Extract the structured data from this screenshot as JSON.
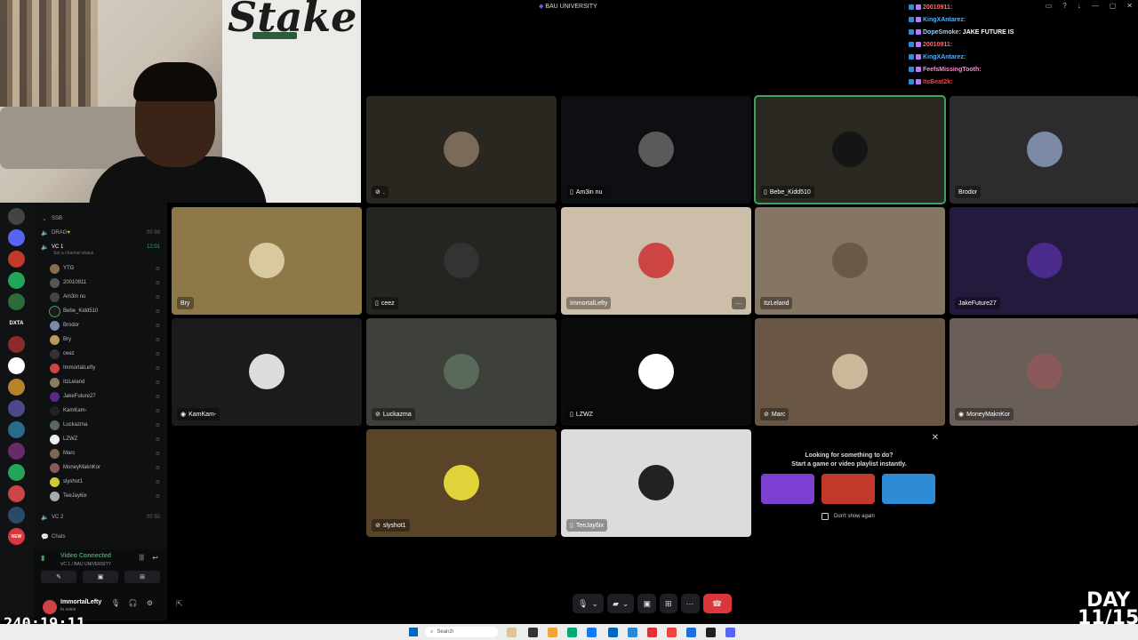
{
  "window": {
    "title": "BAU UNIVERSITY",
    "controls": [
      "▭",
      "?",
      "↓",
      "—",
      "▢",
      "✕"
    ]
  },
  "colors": {
    "discord_green": "#3ba55d",
    "hangup_red": "#da373c",
    "sidebar_bg": "#0f1012"
  },
  "chat": [
    {
      "user": "20010911:",
      "msg": "",
      "color": "#ff6b6b"
    },
    {
      "user": "KingXAntarez:",
      "msg": "",
      "color": "#4fb3ff"
    },
    {
      "user": "DopeSmoke:",
      "msg": "JAKE FUTURE IS",
      "color": "#9ad0ff"
    },
    {
      "user": "20010911:",
      "msg": "",
      "color": "#ff6b6b"
    },
    {
      "user": "KingXAntarez:",
      "msg": "",
      "color": "#4fb3ff"
    },
    {
      "user": "FeefsMissingTooth:",
      "msg": "",
      "color": "#ff8ad8"
    },
    {
      "user": "ItsBeat2k:",
      "msg": "",
      "color": "#ff3b3b"
    }
  ],
  "sidebar": {
    "category": "SSB",
    "channels": [
      {
        "name": "DRAG",
        "counts": "00 99",
        "icon": "speaker-icon"
      },
      {
        "name": "VC 1",
        "counts": "12:01",
        "icon": "speaker-icon",
        "status": "Set a channel status"
      },
      {
        "name": "VC 2",
        "counts": "00 50",
        "icon": "speaker-icon"
      },
      {
        "name": "Chats",
        "counts": "",
        "icon": "chat-icon"
      }
    ],
    "members": [
      {
        "name": "YTG",
        "color": "#8a6b4c"
      },
      {
        "name": "20010911",
        "color": "#555"
      },
      {
        "name": "Am3in nu",
        "color": "#444"
      },
      {
        "name": "Bebe_Kidd510",
        "color": "#1a1a1a"
      },
      {
        "name": "Brodor",
        "color": "#7c8aa8"
      },
      {
        "name": "Bry",
        "color": "#b89a5e"
      },
      {
        "name": "ceez",
        "color": "#333"
      },
      {
        "name": "ImmortalLefty",
        "color": "#c44"
      },
      {
        "name": "ItzLeland",
        "color": "#8b7b62"
      },
      {
        "name": "JakeFuture27",
        "color": "#5a2a8a"
      },
      {
        "name": "KamKam-",
        "color": "#222"
      },
      {
        "name": "Luckazma",
        "color": "#5a6a5a"
      },
      {
        "name": "LZWZ",
        "color": "#eee"
      },
      {
        "name": "Marc",
        "color": "#7c6652"
      },
      {
        "name": "MoneyMaknKor",
        "color": "#8a5a5a"
      },
      {
        "name": "slyshot1",
        "color": "#cc3"
      },
      {
        "name": "TeeJay6ix",
        "color": "#aaa"
      }
    ],
    "voice": {
      "status": "Video Connected",
      "sub": "VC 1 / BAU UNIVERSITY"
    },
    "user": {
      "name": "ImmortalLefty",
      "status": "In voice"
    }
  },
  "tiles": [
    {
      "name": ".",
      "bg": "#2a2620",
      "ava": "#7a6a5a",
      "icon": "mute-icon"
    },
    {
      "name": "Am3in nu",
      "bg": "#0e0f12",
      "ava": "#5a5a5a",
      "icon": "mobile-icon"
    },
    {
      "name": "Bebe_Kidd510",
      "bg": "#2b2822",
      "ava": "#151515",
      "icon": "mobile-icon",
      "speaking": true
    },
    {
      "name": "Brodor",
      "bg": "#2d2b2e",
      "ava": "#7c8aa8",
      "icon": ""
    },
    {
      "name": "Bry",
      "bg": "#8e7848",
      "ava": "#d8c9a0",
      "icon": ""
    },
    {
      "name": "ceez",
      "bg": "#262421",
      "ava": "#333",
      "icon": "mobile-icon"
    },
    {
      "name": "ImmortalLefty",
      "bg": "#cdbeaa",
      "ava": "#c44",
      "icon": "",
      "menu": true
    },
    {
      "name": "ItzLeland",
      "bg": "#847662",
      "ava": "#6a5a45",
      "icon": ""
    },
    {
      "name": "JakeFuture27",
      "bg": "#241a3e",
      "ava": "#4a2a8a",
      "icon": ""
    },
    {
      "name": "KamKam-",
      "bg": "#1b1b1b",
      "ava": "#ddd",
      "icon": "camera-icon"
    },
    {
      "name": "Luckazma",
      "bg": "#3e403c",
      "ava": "#5a6a5a",
      "icon": "mute-icon"
    },
    {
      "name": "LZWZ",
      "bg": "#0b0b0b",
      "ava": "#ffffff",
      "icon": "mobile-icon"
    },
    {
      "name": "Marc",
      "bg": "#6a5645",
      "ava": "#c9b89a",
      "icon": "mute-icon"
    },
    {
      "name": "MoneyMaknKor",
      "bg": "#6a5e58",
      "ava": "#8a5a5a",
      "icon": "camera-icon"
    },
    {
      "name": "slyshot1",
      "bg": "#5a4428",
      "ava": "#e2d23a",
      "icon": "mute-icon"
    },
    {
      "name": "TeeJay6ix",
      "bg": "#dcdcde",
      "ava": "#222",
      "icon": "mobile-icon"
    }
  ],
  "activity": {
    "title_line1": "Looking for something to do?",
    "title_line2": "Start a game or video playlist instantly.",
    "checkbox_label": "Don't show again",
    "games": [
      {
        "label": "",
        "color": "#7b3fd1"
      },
      {
        "label": "",
        "color": "#c0392b"
      },
      {
        "label": "",
        "color": "#2e8bd6"
      }
    ]
  },
  "call_controls": [
    "mic",
    "camera",
    "share-screen",
    "activities",
    "more",
    "hangup"
  ],
  "overlay": {
    "timer": "240:19:11",
    "day_line1": "DAY",
    "day_line2": "11/15"
  },
  "taskbar": {
    "search_placeholder": "Search"
  }
}
